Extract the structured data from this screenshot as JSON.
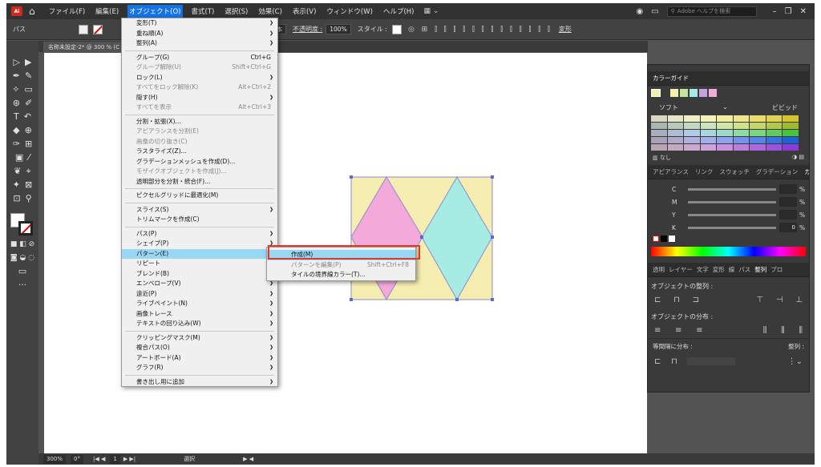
{
  "menubar": {
    "logo": "Ai",
    "items": [
      "ファイル(F)",
      "編集(E)",
      "オブジェクト(O)",
      "書式(T)",
      "選択(S)",
      "効果(C)",
      "表示(V)",
      "ウィンドウ(W)",
      "ヘルプ(H)"
    ],
    "search_placeholder": "Adobe ヘルプを検索"
  },
  "controlbar": {
    "label": "パス",
    "stroke_style": "基本",
    "opacity_label": "不透明度 :",
    "opacity_value": "100%",
    "style_label": "スタイル :",
    "transform_label": "変形"
  },
  "document": {
    "tab_title": "名称未設定-2* @ 300 % (C"
  },
  "object_menu": {
    "groups": [
      [
        {
          "label": "変形(T)",
          "shortcut": "",
          "submenu": true,
          "disabled": false
        },
        {
          "label": "重ね順(A)",
          "shortcut": "",
          "submenu": true,
          "disabled": false
        },
        {
          "label": "整列(A)",
          "shortcut": "",
          "submenu": true,
          "disabled": false
        }
      ],
      [
        {
          "label": "グループ(G)",
          "shortcut": "Ctrl+G",
          "submenu": false,
          "disabled": false
        },
        {
          "label": "グループ解除(U)",
          "shortcut": "Shift+Ctrl+G",
          "submenu": false,
          "disabled": true
        },
        {
          "label": "ロック(L)",
          "shortcut": "",
          "submenu": true,
          "disabled": false
        },
        {
          "label": "すべてをロック解除(K)",
          "shortcut": "Alt+Ctrl+2",
          "submenu": false,
          "disabled": true
        },
        {
          "label": "隠す(H)",
          "shortcut": "",
          "submenu": true,
          "disabled": false
        },
        {
          "label": "すべてを表示",
          "shortcut": "Alt+Ctrl+3",
          "submenu": false,
          "disabled": true
        }
      ],
      [
        {
          "label": "分割・拡張(X)...",
          "shortcut": "",
          "submenu": false,
          "disabled": false
        },
        {
          "label": "アピアランスを分割(E)",
          "shortcut": "",
          "submenu": false,
          "disabled": true
        },
        {
          "label": "画像の切り抜き(C)",
          "shortcut": "",
          "submenu": false,
          "disabled": true
        },
        {
          "label": "ラスタライズ(Z)...",
          "shortcut": "",
          "submenu": false,
          "disabled": false
        },
        {
          "label": "グラデーションメッシュを作成(D)...",
          "shortcut": "",
          "submenu": false,
          "disabled": false
        },
        {
          "label": "モザイクオブジェクトを作成(J)...",
          "shortcut": "",
          "submenu": false,
          "disabled": true
        },
        {
          "label": "透明部分を分割・統合(F)...",
          "shortcut": "",
          "submenu": false,
          "disabled": false
        }
      ],
      [
        {
          "label": "ピクセルグリッドに最適化(M)",
          "shortcut": "",
          "submenu": false,
          "disabled": false
        }
      ],
      [
        {
          "label": "スライス(S)",
          "shortcut": "",
          "submenu": true,
          "disabled": false
        },
        {
          "label": "トリムマークを作成(C)",
          "shortcut": "",
          "submenu": false,
          "disabled": false
        }
      ],
      [
        {
          "label": "パス(P)",
          "shortcut": "",
          "submenu": true,
          "disabled": false
        },
        {
          "label": "シェイプ(P)",
          "shortcut": "",
          "submenu": true,
          "disabled": false
        },
        {
          "label": "パターン(E)",
          "shortcut": "",
          "submenu": true,
          "disabled": false,
          "active": true
        },
        {
          "label": "リピート",
          "shortcut": "",
          "submenu": true,
          "disabled": false
        },
        {
          "label": "ブレンド(B)",
          "shortcut": "",
          "submenu": true,
          "disabled": false
        },
        {
          "label": "エンベロープ(V)",
          "shortcut": "",
          "submenu": true,
          "disabled": false
        },
        {
          "label": "遠近(P)",
          "shortcut": "",
          "submenu": true,
          "disabled": false
        },
        {
          "label": "ライブペイント(N)",
          "shortcut": "",
          "submenu": true,
          "disabled": false
        },
        {
          "label": "画像トレース",
          "shortcut": "",
          "submenu": true,
          "disabled": false
        },
        {
          "label": "テキストの回り込み(W)",
          "shortcut": "",
          "submenu": true,
          "disabled": false
        }
      ],
      [
        {
          "label": "クリッピングマスク(M)",
          "shortcut": "",
          "submenu": true,
          "disabled": false
        },
        {
          "label": "複合パス(O)",
          "shortcut": "",
          "submenu": true,
          "disabled": false
        },
        {
          "label": "アートボード(A)",
          "shortcut": "",
          "submenu": true,
          "disabled": false
        },
        {
          "label": "グラフ(R)",
          "shortcut": "",
          "submenu": true,
          "disabled": false
        }
      ],
      [
        {
          "label": "書き出し用に追加",
          "shortcut": "",
          "submenu": true,
          "disabled": false
        }
      ]
    ]
  },
  "pattern_submenu": [
    {
      "label": "作成(M)",
      "shortcut": "",
      "disabled": false,
      "active": true
    },
    {
      "label": "パターンを編集(P)",
      "shortcut": "Shift+Ctrl+F8",
      "disabled": true
    },
    {
      "label": "タイルの境界線カラー(T)...",
      "shortcut": "",
      "disabled": false
    }
  ],
  "color_guide": {
    "title": "カラーガイド",
    "left_label": "ソフト",
    "right_label": "ビビッド",
    "none_label": "なし",
    "swatches": [
      "#d6d8c2",
      "#e7e5c7",
      "#f1eec5",
      "#f5f1b9",
      "#f2ee9f",
      "#efe68b",
      "#e8dc6d",
      "#dfd24e",
      "#d4c430",
      "#a9b6ae",
      "#b8c9b9",
      "#c2d8bf",
      "#cde3bb",
      "#d1e5a7",
      "#d0e18a",
      "#c4d56a",
      "#b2c74b",
      "#9fbb2c",
      "#a7aebe",
      "#aebdd4",
      "#b1cbe4",
      "#a9d5e0",
      "#9ed9c8",
      "#8fdba5",
      "#7bd57f",
      "#62cb5f",
      "#49c23f",
      "#a9a1b9",
      "#b0a9cc",
      "#b2b0de",
      "#a5aeea",
      "#8fa3f0",
      "#7394ee",
      "#5384e8",
      "#3474e0",
      "#1b64d8",
      "#b7a5b0",
      "#c3a9c2",
      "#cba9cf",
      "#cda3d9",
      "#c792dd",
      "#bd7dde",
      "#ae68dd",
      "#9b53da",
      "#883ed6"
    ]
  },
  "color_panel": {
    "tabs": [
      "アピアランス",
      "リンク",
      "スウォッチ",
      "グラデーション",
      "カラー"
    ],
    "labels": [
      "C",
      "M",
      "Y",
      "K"
    ],
    "values": [
      "",
      "",
      "",
      "0"
    ],
    "unit": "%"
  },
  "align_panel": {
    "tabs": [
      "透明",
      "レイヤー",
      "文字",
      "変形",
      "線",
      "パス",
      "整列",
      "プロ"
    ],
    "object_align_title": "オブジェクトの整列 :",
    "object_distribute_title": "オブジェクトの分布 :",
    "spacing_title": "等間隔に分布 :",
    "align_to_label": "整列 :"
  },
  "statusbar": {
    "zoom": "300%",
    "rotation": "0°",
    "artboard": "1",
    "mode": "選択"
  },
  "artwork": {
    "background": "#f6edb0",
    "left_diamond": "#f3a9da",
    "right_diamond": "#a7ece4"
  }
}
